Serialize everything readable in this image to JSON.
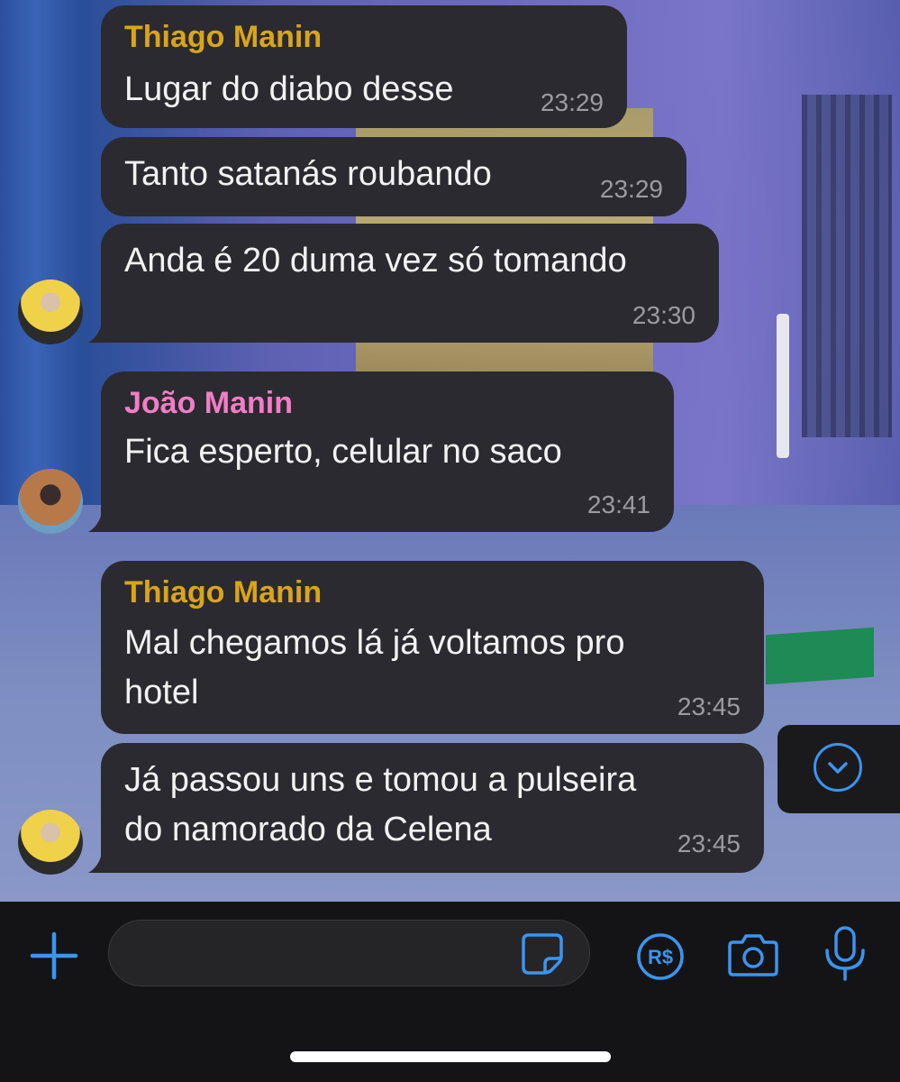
{
  "theme": {
    "bubble_color": "#2b2a30",
    "accent_color": "#3a95f0",
    "sender_colors": {
      "thiago": "#d9a519",
      "joao": "#f07ec6"
    }
  },
  "messages": [
    {
      "sender": "Thiago Manin",
      "lines": [
        "Lugar do diabo desse"
      ],
      "time": "23:29"
    },
    {
      "sender": "",
      "lines": [
        "Tanto satanás roubando"
      ],
      "time": "23:29"
    },
    {
      "sender": "",
      "lines": [
        "Anda é 20 duma vez só tomando"
      ],
      "time": "23:30",
      "avatar": "thiago-avatar"
    },
    {
      "sender": "João Manin",
      "lines": [
        "Fica esperto, celular no saco"
      ],
      "time": "23:41",
      "avatar": "joao-avatar"
    },
    {
      "sender": "Thiago Manin",
      "lines": [
        "Mal chegamos lá já voltamos pro",
        "hotel"
      ],
      "time": "23:45"
    },
    {
      "sender": "",
      "lines": [
        "Já passou uns e tomou a pulseira",
        "do namorado da Celena"
      ],
      "time": "23:45",
      "avatar": "thiago-avatar"
    }
  ],
  "input_bar": {
    "placeholder": "",
    "icons": [
      "plus-icon",
      "sticker-icon",
      "pix-icon",
      "camera-icon",
      "microphone-icon"
    ]
  },
  "scroll_down_icon": "chevron-down-circle-icon"
}
